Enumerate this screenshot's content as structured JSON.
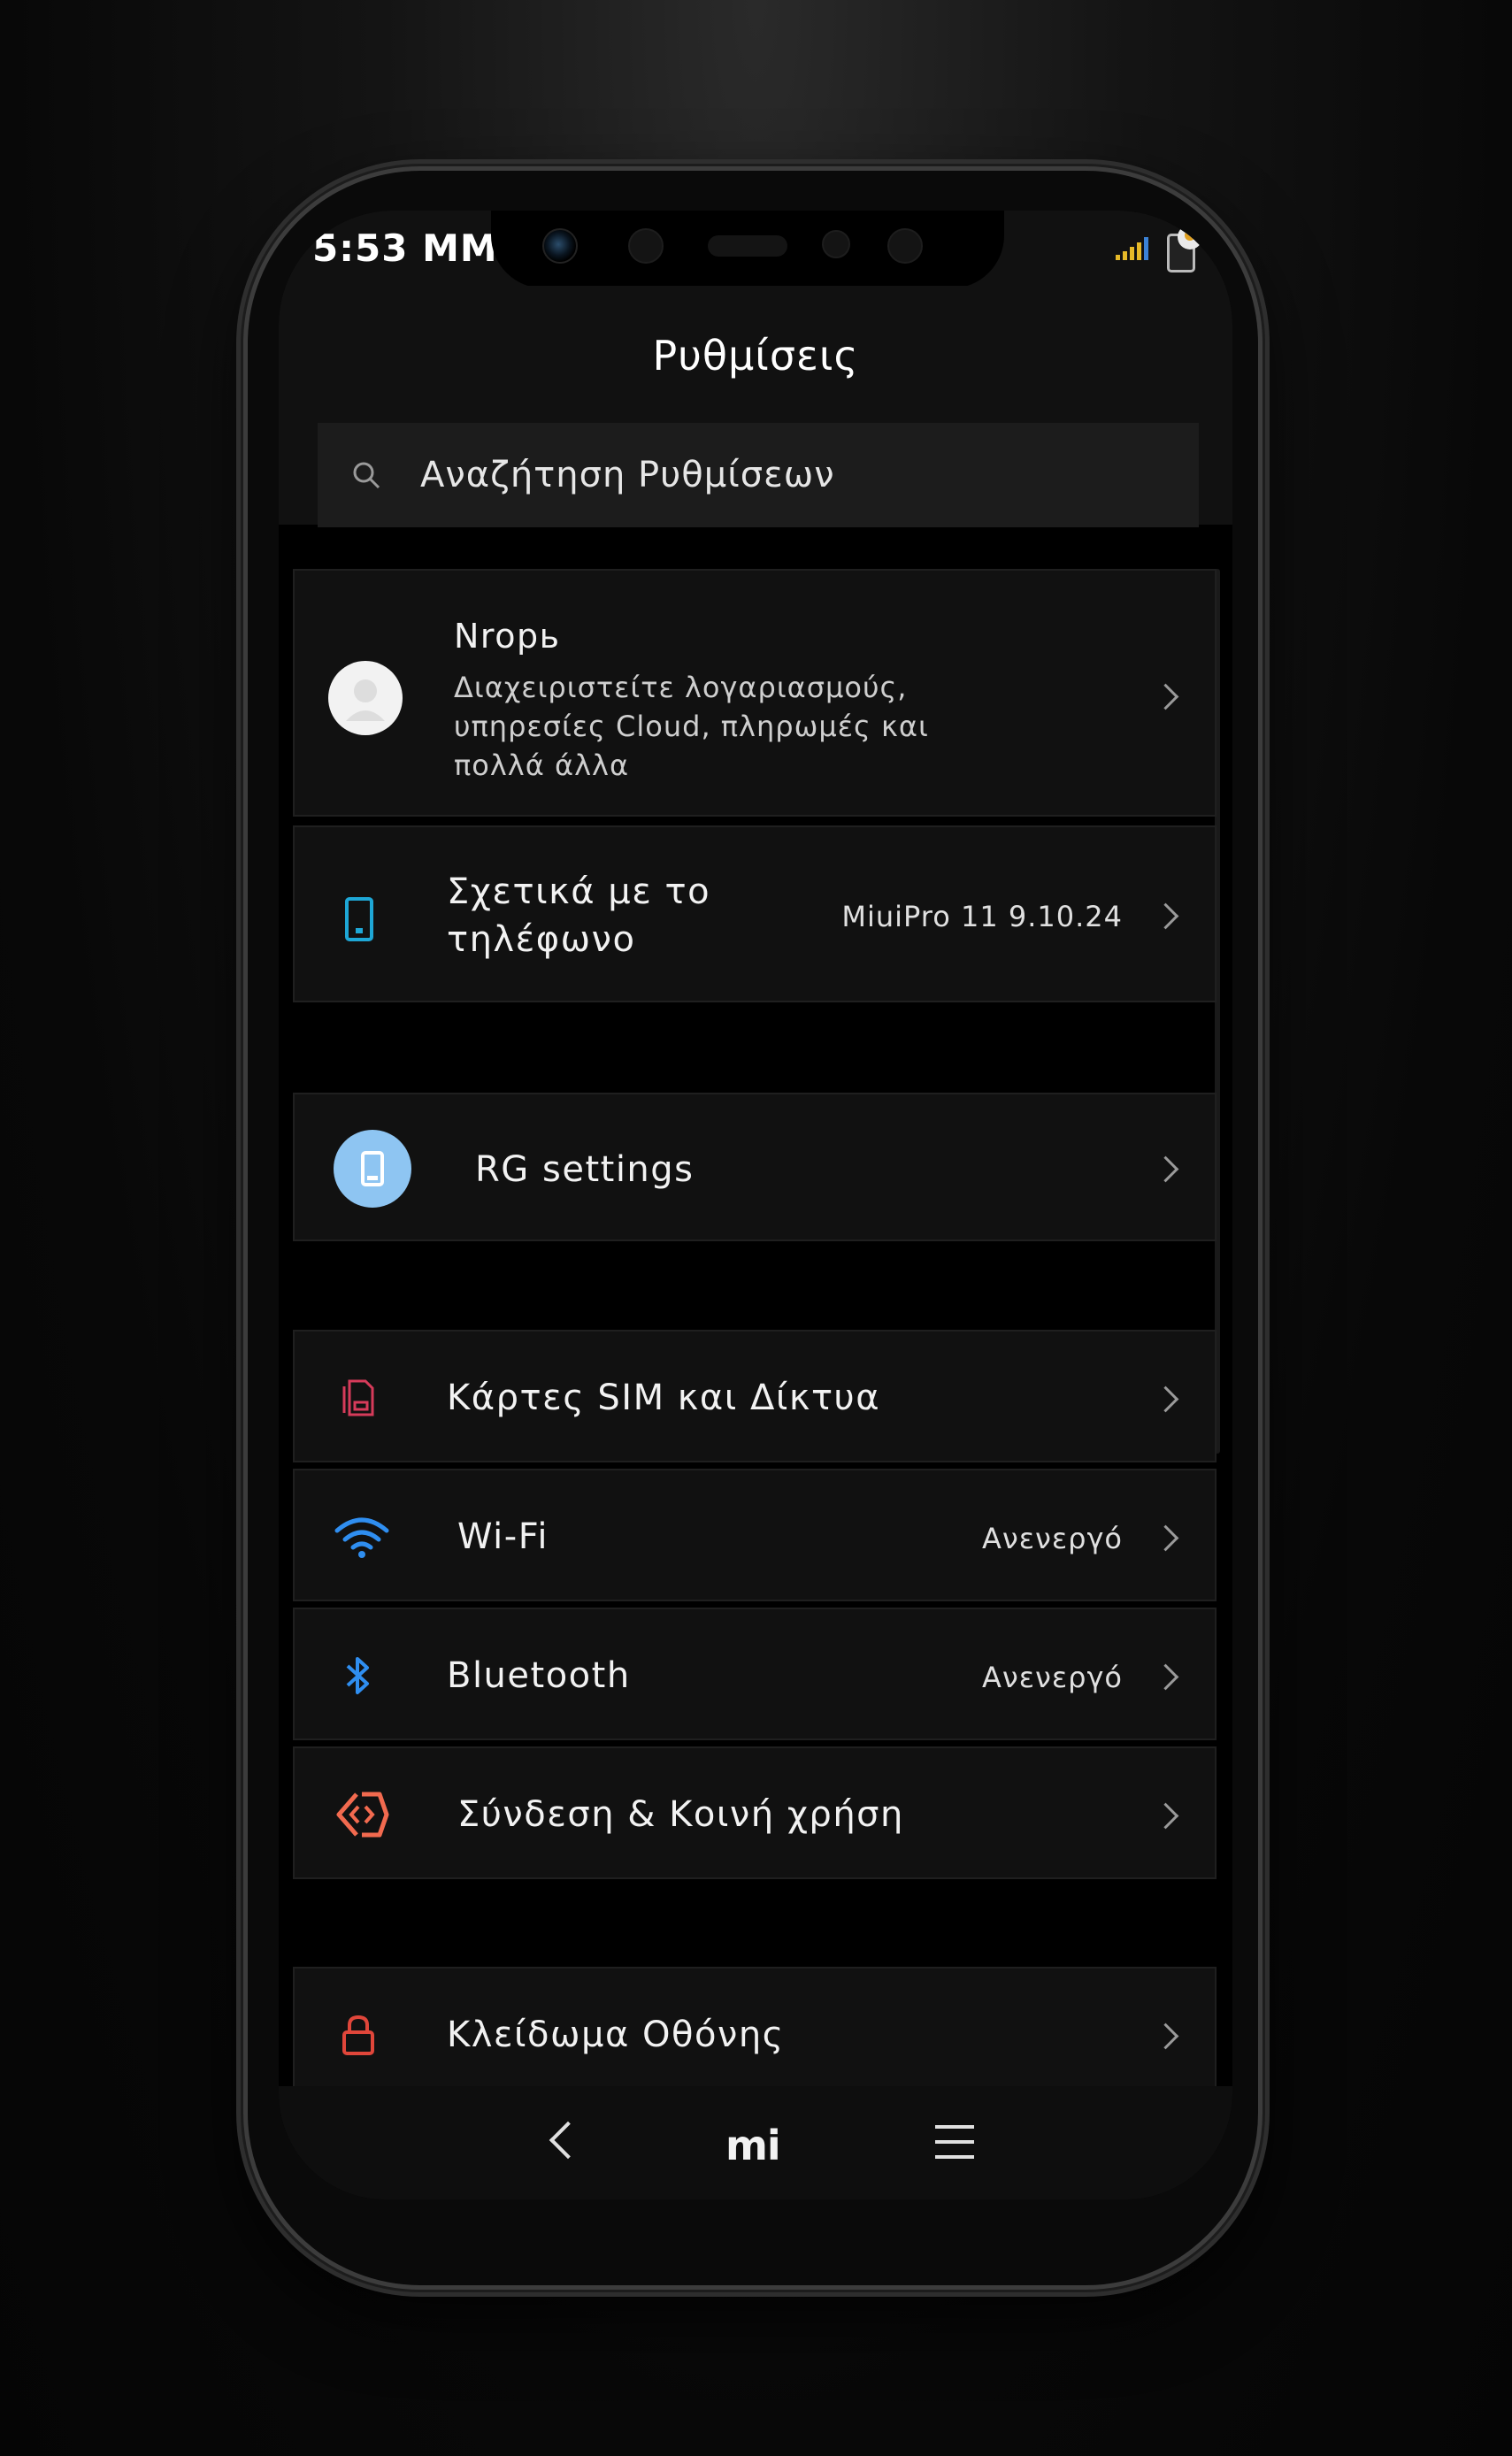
{
  "status_bar": {
    "time": "5:53 MM"
  },
  "header": {
    "title": "Ρυθμίσεις"
  },
  "search": {
    "placeholder": "Αναζήτηση Ρυθμίσεων"
  },
  "account": {
    "name": "Nropь",
    "description_lines": [
      "Διαχειριστείτε λογαριασμούς,",
      "υπηρεσίες Cloud, πληρωμές και",
      "πολλά άλλα"
    ]
  },
  "about_phone": {
    "label_lines": [
      "Σχετικά με το",
      "τηλέφωνο"
    ],
    "value": "MiuiPro 11 9.10.24",
    "icon": "phone-icon"
  },
  "rg_settings": {
    "label": "RG settings",
    "icon": "phone-icon",
    "icon_bg": "#8ec5f2"
  },
  "network_items": [
    {
      "label": "Κάρτες SIM και Δίκτυα",
      "value": "",
      "icon": "sim-card-icon",
      "color": "#d63b5a"
    },
    {
      "label": "Wi-Fi",
      "value": "Ανενεργό",
      "icon": "wifi-icon",
      "color": "#2f8ef0"
    },
    {
      "label": "Bluetooth",
      "value": "Ανενεργό",
      "icon": "bluetooth-icon",
      "color": "#2f8ef0"
    },
    {
      "label": "Σύνδεση & Κοινή χρήση",
      "value": "",
      "icon": "connection-sharing-icon",
      "color": "#f26a4f"
    }
  ],
  "lock_screen": {
    "label": "Κλείδωμα Οθόνης",
    "icon": "lock-icon",
    "color": "#e0463a"
  },
  "navigation": {
    "home_label": "mi",
    "back_icon": "back-icon",
    "menu_icon": "menu-icon"
  }
}
